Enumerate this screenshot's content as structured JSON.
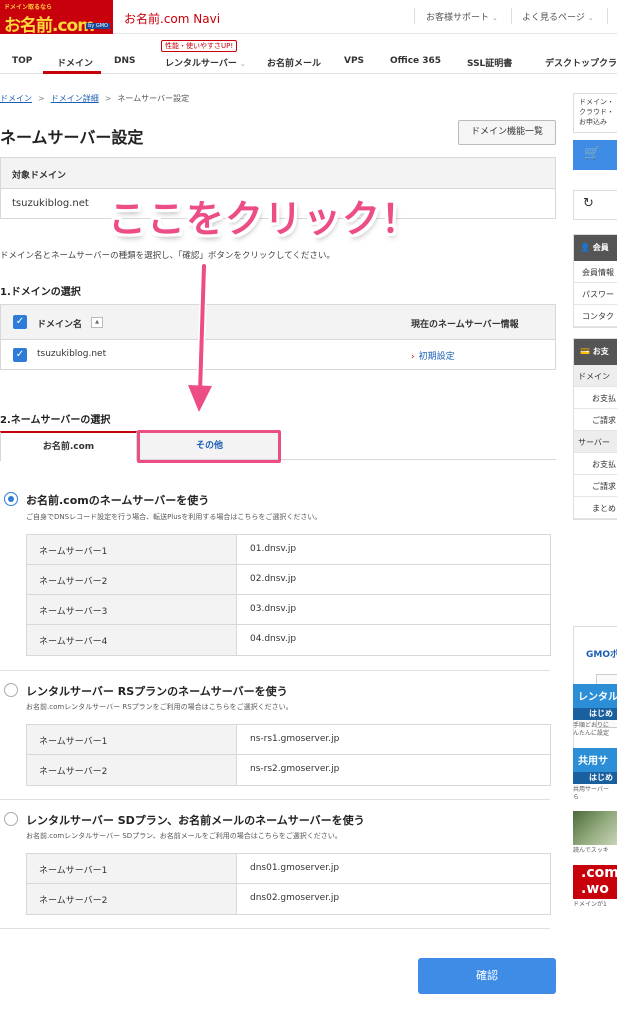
{
  "header": {
    "logo_tagline": "ドメイン取るなら",
    "logo_text": "お名前.com",
    "logo_gmo": "by GMO",
    "app_title": "お名前.com Navi",
    "support_link": "お客様サポート",
    "faq_link": "よく見るページ"
  },
  "nav": {
    "items": [
      "TOP",
      "ドメイン",
      "DNS",
      "レンタルサーバー",
      "お名前メール",
      "VPS",
      "Office 365",
      "SSL証明書",
      "デスクトップクラウ"
    ],
    "promo_badge": "性能・使いやすさUP!"
  },
  "breadcrumb": [
    "ドメイン",
    "ドメイン詳細",
    "ネームサーバー設定"
  ],
  "page": {
    "title": "ネームサーバー設定",
    "domain_function_button": "ドメイン機能一覧",
    "target_domain_label": "対象ドメイン",
    "target_domain_value": "tsuzukiblog.net",
    "instruction": "ドメイン名とネームサーバーの種類を選択し、「確認」ボタンをクリックしてください。",
    "section1_title": "1.ドメインの選択",
    "section2_title": "2.ネームサーバーの選択",
    "confirm_button": "確認"
  },
  "domain_table": {
    "col_domain": "ドメイン名",
    "col_current_ns": "現在のネームサーバー情報",
    "rows": [
      {
        "domain": "tsuzukiblog.net",
        "current_ns": "初期設定"
      }
    ]
  },
  "tabs": {
    "onamae": "お名前.com",
    "other": "その他"
  },
  "options": [
    {
      "title": "お名前.comのネームサーバーを使う",
      "desc": "ご自身でDNSレコード設定を行う場合、転送Plusを利用する場合はこちらをご選択ください。",
      "selected": true,
      "servers": [
        {
          "label": "ネームサーバー1",
          "value": "01.dnsv.jp"
        },
        {
          "label": "ネームサーバー2",
          "value": "02.dnsv.jp"
        },
        {
          "label": "ネームサーバー3",
          "value": "03.dnsv.jp"
        },
        {
          "label": "ネームサーバー4",
          "value": "04.dnsv.jp"
        }
      ]
    },
    {
      "title": "レンタルサーバー RSプランのネームサーバーを使う",
      "desc": "お名前.comレンタルサーバー RSプランをご利用の場合はこちらをご選択ください。",
      "selected": false,
      "servers": [
        {
          "label": "ネームサーバー1",
          "value": "ns-rs1.gmoserver.jp"
        },
        {
          "label": "ネームサーバー2",
          "value": "ns-rs2.gmoserver.jp"
        }
      ]
    },
    {
      "title": "レンタルサーバー SDプラン、お名前メールのネームサーバーを使う",
      "desc": "お名前.comレンタルサーバー SDプラン、お名前メールをご利用の場合はこちらをご選択ください。",
      "selected": false,
      "servers": [
        {
          "label": "ネームサーバー1",
          "value": "dns01.gmoserver.jp"
        },
        {
          "label": "ネームサーバー2",
          "value": "dns02.gmoserver.jp"
        }
      ]
    }
  ],
  "annotation": {
    "callout": "ここをクリック！"
  },
  "sidebar": {
    "notice_lines": [
      "ドメイン・",
      "クラウド・",
      "お申込み"
    ],
    "member_head": "会員",
    "member_items": [
      "会員情報",
      "パスワー",
      "コンタク"
    ],
    "payment_head": "お支",
    "payment_items": [
      {
        "text": "ドメイン",
        "kind": "gray"
      },
      {
        "text": "お支払",
        "kind": "indent"
      },
      {
        "text": "ご請求",
        "kind": "indent"
      },
      {
        "text": "サーバー",
        "kind": "gray"
      },
      {
        "text": "お支払",
        "kind": "indent"
      },
      {
        "text": "ご請求",
        "kind": "indent"
      },
      {
        "text": "まとめ",
        "kind": "indent"
      }
    ],
    "gmo_label": "GMOポ",
    "ad1_banner": "レンタル",
    "ad1_banner2": "はじめ",
    "ad1_text": [
      "手順どおりに",
      "んたんに設定"
    ],
    "ad2_banner": "共用サ",
    "ad2_banner2": "はじめ",
    "ad2_text": [
      "共用サーバー",
      "ら"
    ],
    "ad3_text": "読んでスッキ",
    "ad4_lines": [
      ".com",
      ".wo"
    ],
    "ad4_text": "ドメインが1"
  },
  "colors": {
    "brand_red": "#c8000b",
    "primary_blue": "#3f8ce6",
    "annotation_pink": "#ec4d86"
  }
}
